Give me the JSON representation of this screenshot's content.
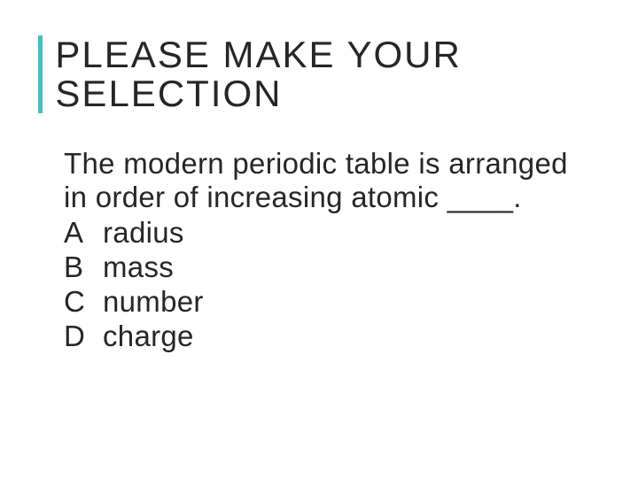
{
  "title": "PLEASE MAKE YOUR SELECTION",
  "question": "The modern periodic table is arranged in order of increasing atomic ____.",
  "options": [
    {
      "letter": "A",
      "text": "radius"
    },
    {
      "letter": "B",
      "text": "mass"
    },
    {
      "letter": "C",
      "text": "number"
    },
    {
      "letter": "D",
      "text": "charge"
    }
  ],
  "colors": {
    "accent": "#3fc0c4",
    "text": "#262626"
  }
}
